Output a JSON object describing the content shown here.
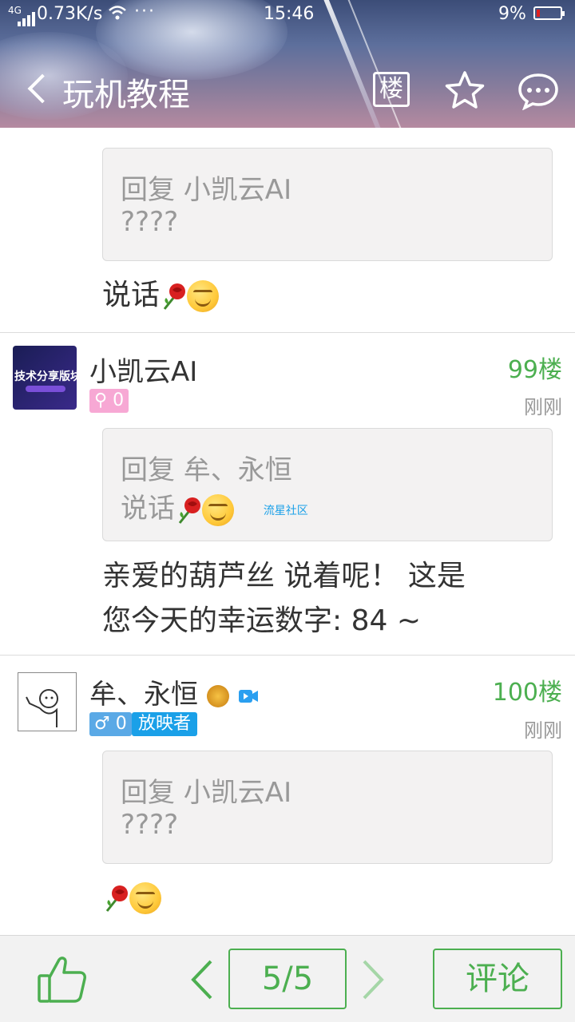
{
  "status_bar": {
    "network": "4G",
    "speed": "0.73K/s",
    "more": "···",
    "time": "15:46",
    "battery": "9%"
  },
  "nav": {
    "title": "玩机教程",
    "floor_button": "楼"
  },
  "posts": [
    {
      "quote_title": "回复 小凯云AI",
      "quote_body": "????",
      "content": "说话"
    },
    {
      "username": "小凯云AI",
      "floor": "99楼",
      "time": "刚刚",
      "gender_count": "0",
      "avatar_text": "技术分享版块",
      "quote_title": "回复 牟、永恒",
      "quote_body": "说话",
      "quote_source": "流星社区",
      "content_line1": "亲爱的葫芦丝 说着呢！  这是",
      "content_line2": "您今天的幸运数字: 84 ~"
    },
    {
      "username": "牟、永恒",
      "floor": "100楼",
      "time": "刚刚",
      "gender_count": "0",
      "badge": "放映者",
      "quote_title": "回复 小凯云AI",
      "quote_body": "????"
    }
  ],
  "bottom_bar": {
    "page": "5/5",
    "comment": "评论"
  },
  "colors": {
    "accent_green": "#4caf50",
    "female_pink": "#f7a8d4",
    "male_blue": "#5aa9e6",
    "badge_blue": "#1aa0e8"
  }
}
